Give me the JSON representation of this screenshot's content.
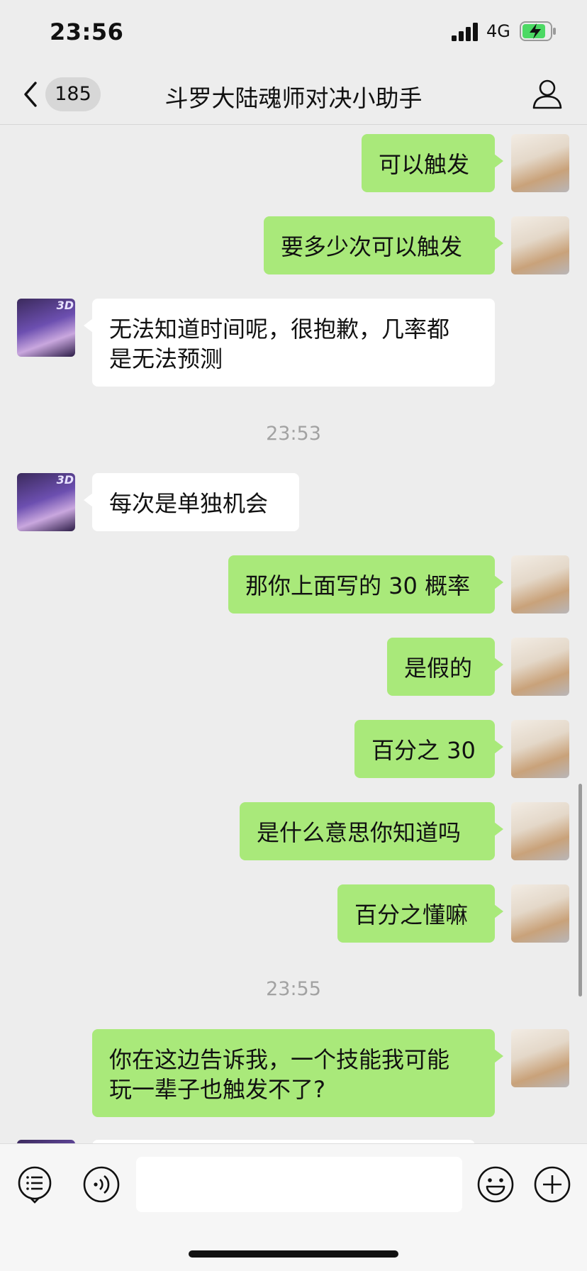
{
  "status_bar": {
    "time": "23:56",
    "network": "4G"
  },
  "nav": {
    "unread_count": "185",
    "title": "斗罗大陆魂师对决小助手"
  },
  "avatar_badge": "3D",
  "messages": [
    {
      "sender": "me",
      "text": "可以触发"
    },
    {
      "sender": "me",
      "text": "要多少次可以触发"
    },
    {
      "sender": "bot",
      "text": "无法知道时间呢，很抱歉，几率都\n是无法预测"
    },
    {
      "type": "time",
      "text": "23:53"
    },
    {
      "sender": "bot",
      "text": "每次是单独机会"
    },
    {
      "sender": "me",
      "text": "那你上面写的 30 概率"
    },
    {
      "sender": "me",
      "text": "是假的"
    },
    {
      "sender": "me",
      "text": "百分之 30"
    },
    {
      "sender": "me",
      "text": "是什么意思你知道吗"
    },
    {
      "sender": "me",
      "text": "百分之懂嘛"
    },
    {
      "type": "time",
      "text": "23:55"
    },
    {
      "sender": "me",
      "text": "你在这边告诉我，一个技能我可能\n玩一辈子也触发不了?"
    }
  ],
  "input": {
    "value": "",
    "placeholder": ""
  },
  "colors": {
    "my_bubble": "#a9e97a",
    "their_bubble": "#ffffff",
    "background": "#ededed",
    "battery_fill": "#4cd964"
  },
  "icons": {
    "back": "chevron-left-icon",
    "profile": "person-icon",
    "list": "list-menu-icon",
    "voice": "voice-icon",
    "emoji": "smiley-icon",
    "more": "plus-icon"
  }
}
